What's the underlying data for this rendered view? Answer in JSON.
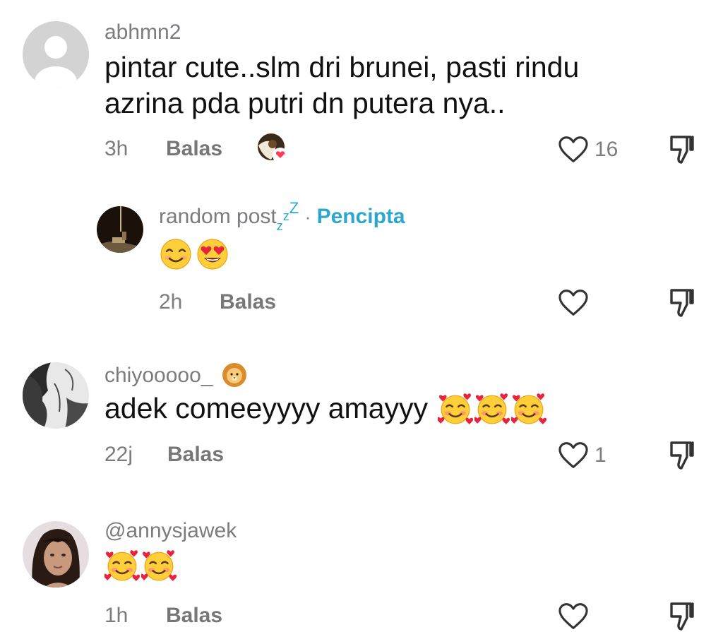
{
  "comments": [
    {
      "username": "abhmn2",
      "text": "pintar cute..slm dri brunei, pasti rindu azrina pda putri dn putera nya..",
      "time": "3h",
      "reply_label": "Balas",
      "like_count": "16",
      "replies": [
        {
          "username": "random post",
          "username_suffix": [
            "z",
            "z",
            "Z"
          ],
          "separator": "·",
          "creator_label": "Pencipta",
          "emojis": [
            "smiling-face-icon",
            "heart-eyes-face-icon"
          ],
          "time": "2h",
          "reply_label": "Balas"
        }
      ]
    },
    {
      "username": "chiyooooo_",
      "username_emoji": "lion-face-icon",
      "text": "adek comeeyyyy amayyy",
      "emojis": [
        "smiling-face-with-hearts-icon",
        "smiling-face-with-hearts-icon",
        "smiling-face-with-hearts-icon"
      ],
      "time": "22j",
      "reply_label": "Balas",
      "like_count": "1"
    },
    {
      "username": "@annysjawek",
      "emojis": [
        "smiling-face-with-hearts-icon",
        "smiling-face-with-hearts-icon"
      ],
      "time": "1h",
      "reply_label": "Balas"
    }
  ],
  "colors": {
    "creator_accent": "#2ea7ce",
    "muted_text": "#7b7b80",
    "body_text": "#111111",
    "like_heart": "#ff3b5c"
  }
}
